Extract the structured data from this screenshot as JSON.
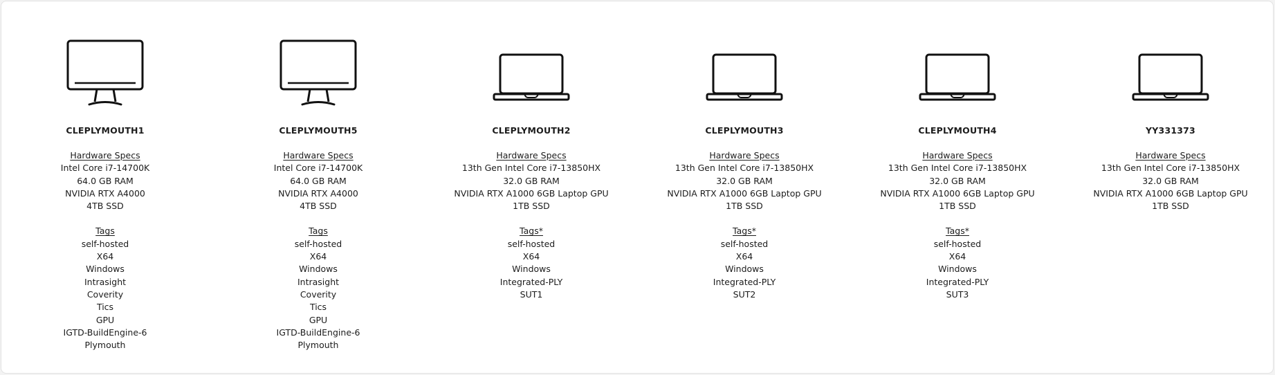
{
  "labels": {
    "hardware_specs": "Hardware Specs"
  },
  "machines": [
    {
      "name": "CLEPLYMOUTH1",
      "icon": "desktop-monitor-icon",
      "specs": [
        "Intel Core i7-14700K",
        "64.0 GB RAM",
        "NVIDIA RTX A4000",
        "4TB SSD"
      ],
      "tags_label": "Tags",
      "tags": [
        "self-hosted",
        "X64",
        "Windows",
        "Intrasight",
        "Coverity",
        "Tics",
        "GPU",
        "IGTD-BuildEngine-6",
        "Plymouth"
      ]
    },
    {
      "name": "CLEPLYMOUTH5",
      "icon": "desktop-monitor-icon",
      "specs": [
        "Intel Core i7-14700K",
        "64.0 GB RAM",
        "NVIDIA RTX A4000",
        "4TB SSD"
      ],
      "tags_label": "Tags",
      "tags": [
        "self-hosted",
        "X64",
        "Windows",
        "Intrasight",
        "Coverity",
        "Tics",
        "GPU",
        "IGTD-BuildEngine-6",
        "Plymouth"
      ]
    },
    {
      "name": "CLEPLYMOUTH2",
      "icon": "laptop-icon",
      "specs": [
        "13th Gen Intel Core i7-13850HX",
        "32.0 GB RAM",
        "NVIDIA RTX A1000 6GB Laptop GPU",
        "1TB SSD"
      ],
      "tags_label": "Tags*",
      "tags": [
        "self-hosted",
        "X64",
        "Windows",
        "Integrated-PLY",
        "SUT1"
      ]
    },
    {
      "name": "CLEPLYMOUTH3",
      "icon": "laptop-icon",
      "specs": [
        "13th Gen Intel Core i7-13850HX",
        "32.0 GB RAM",
        "NVIDIA RTX A1000 6GB Laptop GPU",
        "1TB SSD"
      ],
      "tags_label": "Tags*",
      "tags": [
        "self-hosted",
        "X64",
        "Windows",
        "Integrated-PLY",
        "SUT2"
      ]
    },
    {
      "name": "CLEPLYMOUTH4",
      "icon": "laptop-icon",
      "specs": [
        "13th Gen Intel Core i7-13850HX",
        "32.0 GB RAM",
        "NVIDIA RTX A1000 6GB Laptop GPU",
        "1TB SSD"
      ],
      "tags_label": "Tags*",
      "tags": [
        "self-hosted",
        "X64",
        "Windows",
        "Integrated-PLY",
        "SUT3"
      ]
    },
    {
      "name": "YY331373",
      "icon": "laptop-icon",
      "specs": [
        "13th Gen Intel Core i7-13850HX",
        "32.0 GB RAM",
        "NVIDIA RTX A1000 6GB Laptop GPU",
        "1TB SSD"
      ],
      "tags_label": "",
      "tags": []
    }
  ]
}
